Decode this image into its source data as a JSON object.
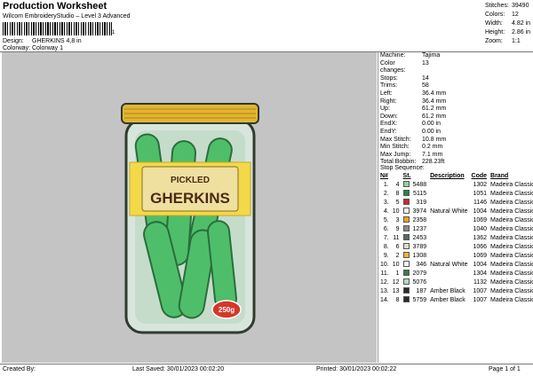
{
  "header": {
    "title": "Production Worksheet",
    "subtitle": "Wilcom EmbroideryStudio – Level 3 Advanced",
    "barcode_mark": "1",
    "design_label": "Design:",
    "design_value": "GHERKINS 4,8 in",
    "colorway_label": "Colorway:",
    "colorway_value": "Colorway 1"
  },
  "summary": [
    {
      "label": "Stitches:",
      "value": "39490"
    },
    {
      "label": "Colors:",
      "value": "12"
    },
    {
      "label": "Width:",
      "value": "4.82 in"
    },
    {
      "label": "Height:",
      "value": "2.86 in"
    },
    {
      "label": "Zoom:",
      "value": "1:1"
    }
  ],
  "design_image": {
    "lid_color": "#e2b531",
    "jar_outline": "#2f3b2e",
    "pickle_color": "#4fbe6a",
    "label_band_color": "#f3d94a",
    "label_line1": "PICKLED",
    "label_line2": "GHERKINS",
    "badge_text": "250g",
    "badge_color": "#d6362a"
  },
  "machine_info": [
    {
      "label": "Machine:",
      "value": "Tajima"
    },
    {
      "label": "Color changes:",
      "value": "13"
    },
    {
      "label": "Stops:",
      "value": "14"
    },
    {
      "label": "Trims:",
      "value": "58"
    },
    {
      "label": "Left:",
      "value": "36.4 mm"
    },
    {
      "label": "Right:",
      "value": "36.4 mm"
    },
    {
      "label": "Up:",
      "value": "61.2 mm"
    },
    {
      "label": "Down:",
      "value": "61.2 mm"
    },
    {
      "label": "EndX:",
      "value": "0.00 in"
    },
    {
      "label": "EndY:",
      "value": "0.00 in"
    },
    {
      "label": "Max Stitch:",
      "value": "10.8 mm"
    },
    {
      "label": "Min Stitch:",
      "value": "0.2 mm"
    },
    {
      "label": "Max Jump:",
      "value": "7.1 mm"
    },
    {
      "label": "Total Bobbin:",
      "value": "228.23ft"
    }
  ],
  "sequence": {
    "title": "Stop Sequence:",
    "headers": [
      "N#",
      "St.",
      "Code",
      "Brand"
    ],
    "desc_header": "Description",
    "rows": [
      {
        "n": "1.",
        "idx": "4",
        "color": "#8fd3a0",
        "st": "5488",
        "desc": "",
        "code": "1302",
        "brand": "Madeira Classic 40"
      },
      {
        "n": "2.",
        "idx": "8",
        "color": "#1a8a45",
        "st": "5115",
        "desc": "",
        "code": "1051",
        "brand": "Madeira Classic 40"
      },
      {
        "n": "3.",
        "idx": "5",
        "color": "#c62828",
        "st": "319",
        "desc": "",
        "code": "1146",
        "brand": "Madeira Classic 40"
      },
      {
        "n": "4.",
        "idx": "10",
        "color": "#f4f4f4",
        "st": "3974",
        "desc": "Natural White",
        "code": "1004",
        "brand": "Madeira Classic 40"
      },
      {
        "n": "5.",
        "idx": "3",
        "color": "#e8a31e",
        "st": "2358",
        "desc": "",
        "code": "1069",
        "brand": "Madeira Classic 40"
      },
      {
        "n": "6.",
        "idx": "9",
        "color": "#8a8a8a",
        "st": "1237",
        "desc": "",
        "code": "1040",
        "brand": "Madeira Classic 40"
      },
      {
        "n": "7.",
        "idx": "11",
        "color": "#5a6a5e",
        "st": "2453",
        "desc": "",
        "code": "1362",
        "brand": "Madeira Classic 40"
      },
      {
        "n": "8.",
        "idx": "6",
        "color": "#e7d7c8",
        "st": "3789",
        "desc": "",
        "code": "1066",
        "brand": "Madeira Classic 40"
      },
      {
        "n": "9.",
        "idx": "2",
        "color": "#f0b52a",
        "st": "1308",
        "desc": "",
        "code": "1069",
        "brand": "Madeira Classic 40"
      },
      {
        "n": "10.",
        "idx": "10",
        "color": "#f4f4f4",
        "st": "346",
        "desc": "Natural White",
        "code": "1004",
        "brand": "Madeira Classic 40"
      },
      {
        "n": "11.",
        "idx": "1",
        "color": "#3f7a4a",
        "st": "2079",
        "desc": "",
        "code": "1304",
        "brand": "Madeira Classic 40"
      },
      {
        "n": "12.",
        "idx": "12",
        "color": "#b9d7c4",
        "st": "5076",
        "desc": "",
        "code": "1132",
        "brand": "Madeira Classic 40"
      },
      {
        "n": "13.",
        "idx": "13",
        "color": "#2a2a2a",
        "st": "187",
        "desc": "Amber Black",
        "code": "1007",
        "brand": "Madeira Classic 40"
      },
      {
        "n": "14.",
        "idx": "8",
        "color": "#2a2a2a",
        "st": "5759",
        "desc": "Amber Black",
        "code": "1007",
        "brand": "Madeira Classic 40"
      }
    ]
  },
  "footer": {
    "created_by": "Created By:",
    "last_saved": "Last Saved: 30/01/2023 00:02:20",
    "printed": "Printed: 30/01/2023 00:02:22",
    "page": "Page 1 of 1"
  }
}
